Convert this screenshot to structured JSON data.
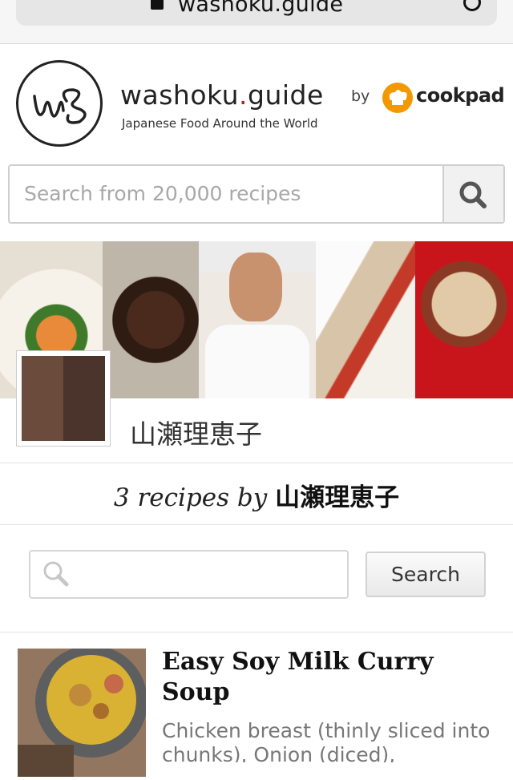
{
  "browser": {
    "url": "washoku.guide"
  },
  "header": {
    "brand_pre": "washoku",
    "brand_dot": ".",
    "brand_post": "guide",
    "tagline": "Japanese Food Around the World",
    "by": "by",
    "partner": "cookpad",
    "colors": {
      "accent": "#c0182b",
      "cookpad": "#f39800"
    }
  },
  "search": {
    "placeholder": "Search from 20,000 recipes",
    "icon": "search-icon"
  },
  "profile": {
    "name": "山瀬理恵子"
  },
  "recipes_header": {
    "count_text": "3 recipes by",
    "name": "山瀬理恵子"
  },
  "filter": {
    "value": "",
    "button": "Search"
  },
  "recipes": [
    {
      "title": "Easy Soy Milk Curry Soup",
      "description": "Chicken breast (thinly sliced into chunks), Onion (diced),"
    }
  ]
}
